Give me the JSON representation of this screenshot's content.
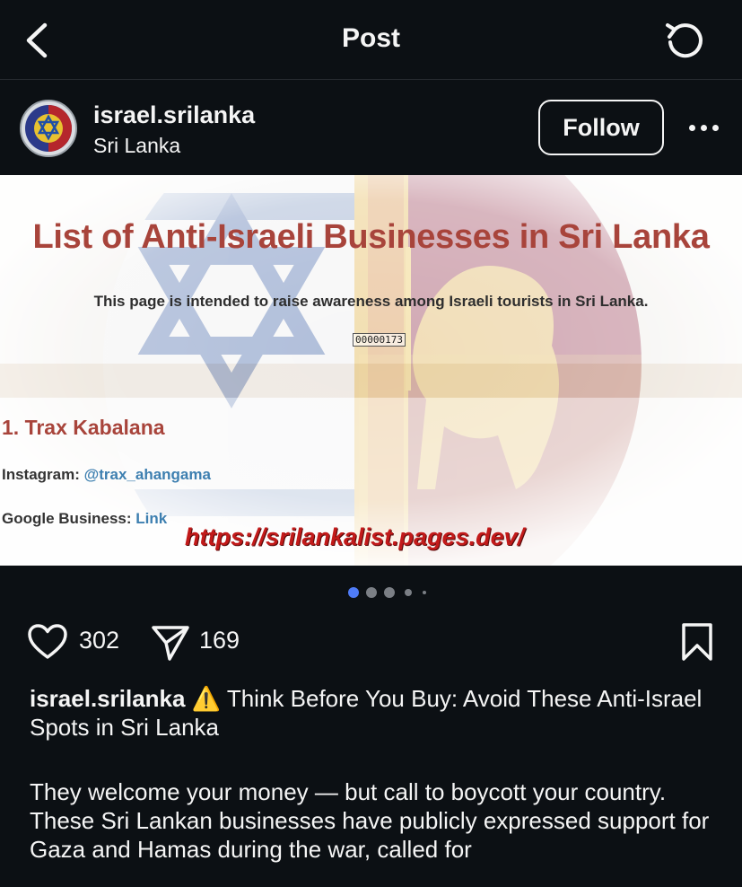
{
  "header": {
    "title": "Post",
    "back_icon": "chevron-left-icon",
    "refresh_icon": "refresh-icon"
  },
  "post": {
    "username": "israel.srilanka",
    "location": "Sri Lanka",
    "follow_label": "Follow",
    "more_icon": "more-horizontal-icon"
  },
  "image": {
    "title": "List of Anti-Israeli Businesses in Sri Lanka",
    "subtitle": "This page is intended to raise awareness among Israeli tourists in Sri Lanka.",
    "counter": "00000173",
    "business_name": "1. Trax Kabalana",
    "instagram_label": "Instagram:",
    "instagram_value": "@trax_ahangama",
    "google_label": "Google Business:",
    "google_value": "Link",
    "url": "https://srilankalist.pages.dev/"
  },
  "carousel": {
    "total": 5,
    "active_index": 0,
    "active_color": "#4f7cf7",
    "inactive_color": "#7b7f85"
  },
  "actions": {
    "like_count": "302",
    "share_count": "169",
    "like_icon": "heart-icon",
    "share_icon": "send-icon",
    "save_icon": "bookmark-icon"
  },
  "caption": {
    "username": "israel.srilanka",
    "emoji": "⚠️",
    "text": "Think Before You Buy: Avoid These Anti-Israel Spots in Sri Lanka",
    "line1": "They welcome your money — but call to boycott your country.",
    "line2": "These Sri Lankan businesses have publicly expressed support for Gaza and Hamas during the war, called for"
  },
  "colors": {
    "background": "#0c1014",
    "text": "#f5f5f5",
    "image_title": "#a8443b",
    "link_blue": "#3d7fb0",
    "url_red": "#c21a1a"
  }
}
